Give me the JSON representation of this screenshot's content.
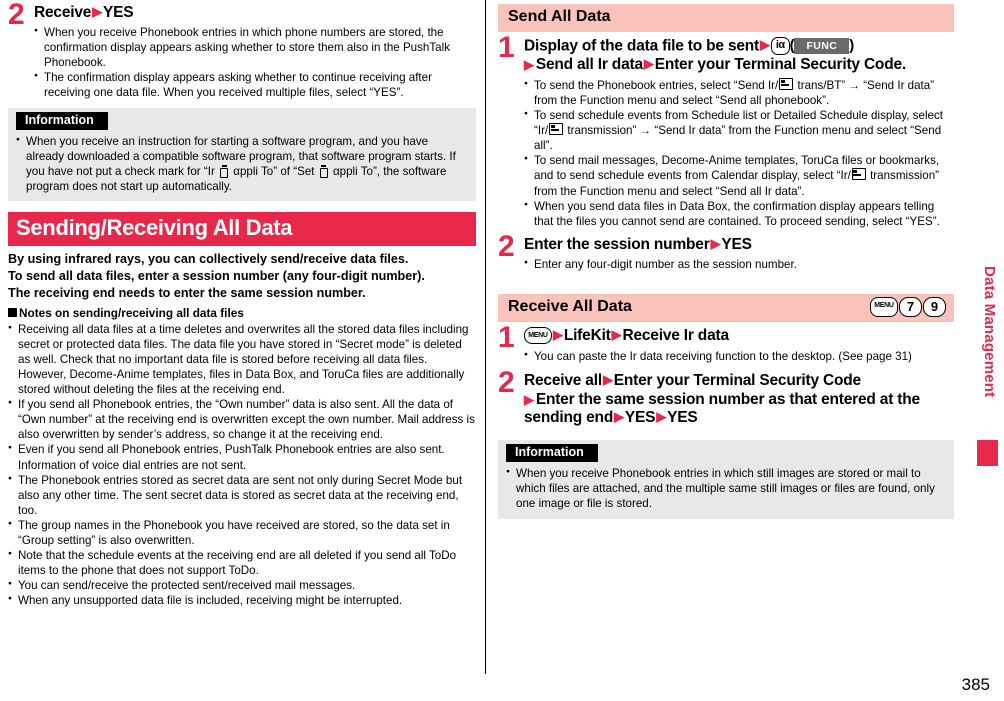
{
  "page_number": "385",
  "side_tab_label": "Data Management",
  "left_column": {
    "step2": {
      "number": "2",
      "title_part1": "Receive",
      "arrow": "▶",
      "title_part2": "YES",
      "bullets": [
        "When you receive Phonebook entries in which phone numbers are stored, the confirmation display appears asking whether to store them also in the PushTalk Phonebook.",
        "The confirmation display appears asking whether to continue receiving after receiving one data file. When you received multiple files, select “YES”."
      ]
    },
    "information": {
      "tag": "Information",
      "bullet_pre": "When you receive an instruction for starting a software program, and you have already downloaded a compatible software program, that software program starts. If you have not put a check mark for “Ir ",
      "icon1": "i-appli-icon",
      "bullet_mid": " αppli To” of “Set ",
      "icon2": "i-appli-icon",
      "bullet_post": " αppli To”, the software program does not start up automatically."
    },
    "section_banner": "Sending/Receiving All Data",
    "lead_lines": [
      "By using infrared rays, you can collectively send/receive data files.",
      "To send all data files, enter a session number (any four-digit number).",
      "The receiving end needs to enter the same session number."
    ],
    "notes_heading": "Notes on sending/receiving all data files",
    "notes": [
      {
        "text": "Receiving all data files at a time deletes and overwrites all the stored data files including secret or protected data files. The data file you have stored in “Secret mode” is deleted as well. Check that no important data file is stored before receiving all data files.",
        "subline": "However, Decome-Anime templates, files in Data Box, and ToruCa files are additionally stored without deleting the files at the receiving end."
      },
      {
        "text": "If you send all Phonebook entries, the “Own number” data is also sent. All the data of “Own number” at the receiving end is overwritten except the own number. Mail address is also overwritten by sender’s address, so change it at the receiving end.",
        "subline": ""
      },
      {
        "text": "Even if you send all Phonebook entries, PushTalk Phonebook entries are also sent. Information of voice dial entries are not sent.",
        "subline": ""
      },
      {
        "text": "The Phonebook entries stored as secret data are sent not only during Secret Mode but also any other time. The sent secret data is stored as secret data at the receiving end, too.",
        "subline": ""
      },
      {
        "text": "The group names in the Phonebook you have received are stored, so the data set in “Group setting” is also overwritten.",
        "subline": ""
      },
      {
        "text": "Note that the schedule events at the receiving end are all deleted if you send all ToDo items to the phone that does not support ToDo.",
        "subline": ""
      },
      {
        "text": "You can send/receive the protected sent/received mail messages.",
        "subline": ""
      },
      {
        "text": "When any unsupported data file is included, receiving might be interrupted.",
        "subline": ""
      }
    ]
  },
  "right_column": {
    "send_all": {
      "banner": "Send All Data",
      "step1": {
        "number": "1",
        "line1_pre": "Display of the data file to be sent",
        "key_ialpha": "iα",
        "func_label": "FUNC",
        "line2_a": "Send all Ir data",
        "line2_b": "Enter your Terminal Security Code."
      },
      "step1_bullets": [
        {
          "pre": "To send the Phonebook entries, select “Send Ir/",
          "icon": "ic-transmission-icon",
          "post": " trans/BT” → “Send Ir data” from the Function menu and select “Send all phonebook”."
        },
        {
          "pre": "To send schedule events from Schedule list or Detailed Schedule display, select “Ir/",
          "icon": "ic-transmission-icon",
          "post": " transmission” → “Send Ir data” from the Function menu and select “Send all”."
        },
        {
          "pre": "To send mail messages, Decome-Anime templates, ToruCa files or bookmarks, and to send schedule events from Calendar display, select “Ir/",
          "icon": "ic-transmission-icon",
          "post": " transmission” from the Function menu and select “Send all Ir data”."
        },
        {
          "pre": "When you send data files in Data Box, the confirmation display appears telling that the files you cannot send are contained. To proceed sending, select “YES”.",
          "icon": "",
          "post": ""
        }
      ],
      "step2": {
        "number": "2",
        "title_part1": "Enter the session number",
        "title_part2": "YES",
        "bullets": [
          "Enter any four-digit number as the session number."
        ]
      }
    },
    "receive_all": {
      "banner": "Receive All Data",
      "keys": [
        "MENU",
        "7",
        "9"
      ],
      "step1": {
        "number": "1",
        "key_menu": "MENU",
        "title_part1": "LifeKit",
        "title_part2": "Receive Ir data",
        "bullets": [
          "You can paste the Ir data receiving function to the desktop. (See page 31)"
        ]
      },
      "step2": {
        "number": "2",
        "line1_a": "Receive all",
        "line1_b": "Enter your Terminal Security Code",
        "line2_a": "Enter the same session number as that entered at the",
        "line3_a": "sending end",
        "line3_b": "YES",
        "line3_c": "YES"
      },
      "information": {
        "tag": "Information",
        "bullets": [
          "When you receive Phonebook entries in which still images are stored or mail to which files are attached, and the multiple same still images or files are found, only one image or file is stored."
        ]
      }
    }
  },
  "colors": {
    "accent_red": "#e8274b",
    "banner_pink": "#fac4bc",
    "info_gray": "#e8e8e8",
    "func_gray": "#6a6a6a"
  }
}
